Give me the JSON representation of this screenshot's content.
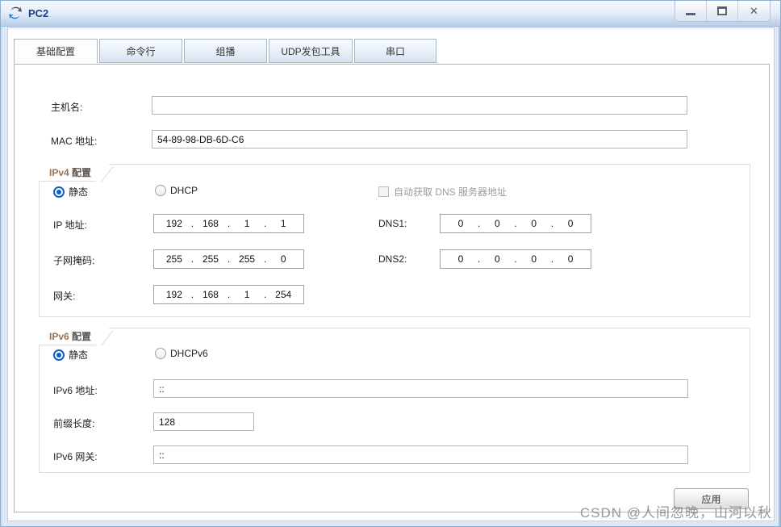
{
  "window": {
    "title": "PC2",
    "controls": {
      "minimize": "minimize",
      "maximize": "maximize",
      "close": "✕"
    }
  },
  "tabs": [
    {
      "label": "基础配置",
      "active": true
    },
    {
      "label": "命令行",
      "active": false
    },
    {
      "label": "组播",
      "active": false
    },
    {
      "label": "UDP发包工具",
      "active": false
    },
    {
      "label": "串口",
      "active": false
    }
  ],
  "form": {
    "hostname": {
      "label": "主机名:",
      "value": ""
    },
    "mac": {
      "label": "MAC 地址:",
      "value": "54-89-98-DB-6D-C6"
    },
    "ipv4": {
      "group_label_prefix": "IPv4",
      "group_label_suffix": "配置",
      "static_label": "静态",
      "dhcp_label": "DHCP",
      "auto_dns_label": "自动获取 DNS 服务器地址",
      "ip": {
        "label": "IP 地址:",
        "octets": [
          "192",
          "168",
          "1",
          "1"
        ]
      },
      "mask": {
        "label": "子网掩码:",
        "octets": [
          "255",
          "255",
          "255",
          "0"
        ]
      },
      "gateway": {
        "label": "网关:",
        "octets": [
          "192",
          "168",
          "1",
          "254"
        ]
      },
      "dns1": {
        "label": "DNS1:",
        "octets": [
          "0",
          "0",
          "0",
          "0"
        ]
      },
      "dns2": {
        "label": "DNS2:",
        "octets": [
          "0",
          "0",
          "0",
          "0"
        ]
      }
    },
    "ipv6": {
      "group_label_prefix": "IPv6",
      "group_label_suffix": "配置",
      "static_label": "静态",
      "dhcp_label": "DHCPv6",
      "address": {
        "label": "IPv6 地址:",
        "value": "::"
      },
      "prefix": {
        "label": "前缀长度:",
        "value": "128"
      },
      "gateway": {
        "label": "IPv6 网关:",
        "value": "::"
      }
    },
    "apply_label": "应用"
  },
  "watermark": "CSDN @人间忽晚，山河以秋",
  "colors": {
    "accent_blue": "#0e5fc4",
    "titlebar_text": "#1a3e8c",
    "watermark_grey": "#7d7d7d",
    "group_border": "#dcdcdc"
  }
}
